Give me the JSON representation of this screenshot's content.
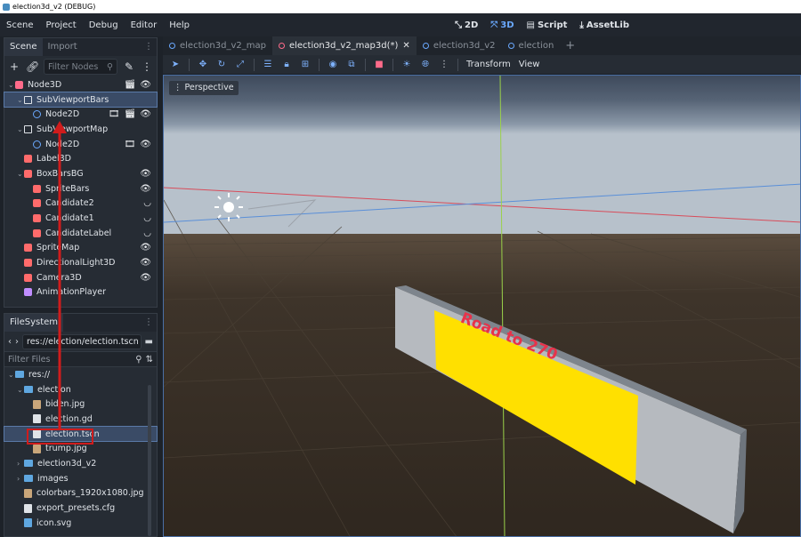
{
  "window": {
    "title": "election3d_v2 (DEBUG)"
  },
  "menu": [
    "Scene",
    "Project",
    "Debug",
    "Editor",
    "Help"
  ],
  "modes": [
    {
      "label": "2D",
      "icon": "2d-icon"
    },
    {
      "label": "3D",
      "icon": "3d-icon",
      "active": true
    },
    {
      "label": "Script",
      "icon": "script-icon"
    },
    {
      "label": "AssetLib",
      "icon": "assetlib-icon"
    }
  ],
  "scene_dock": {
    "tabs": [
      "Scene",
      "Import"
    ],
    "filter_placeholder": "Filter Nodes",
    "nodes": [
      {
        "label": "Node3D",
        "depth": 0,
        "icon_color": "#ff6b8a"
      },
      {
        "label": "SubViewportBars",
        "depth": 1,
        "icon_color": "#dfe3e8",
        "selected": true
      },
      {
        "label": "Node2D",
        "depth": 2,
        "icon_color": "#6aa9ff"
      },
      {
        "label": "SubViewportMap",
        "depth": 1,
        "icon_color": "#dfe3e8"
      },
      {
        "label": "Node2D",
        "depth": 2,
        "icon_color": "#6aa9ff"
      },
      {
        "label": "Label3D",
        "depth": 1,
        "icon_color": "#ff6b6b"
      },
      {
        "label": "BoxBarsBG",
        "depth": 1,
        "icon_color": "#ff6b6b"
      },
      {
        "label": "SpriteBars",
        "depth": 2,
        "icon_color": "#ff6b6b"
      },
      {
        "label": "Candidate2",
        "depth": 2,
        "icon_color": "#ff6b6b"
      },
      {
        "label": "Candidate1",
        "depth": 2,
        "icon_color": "#ff6b6b"
      },
      {
        "label": "CandidateLabel",
        "depth": 2,
        "icon_color": "#ff6b6b"
      },
      {
        "label": "SpriteMap",
        "depth": 1,
        "icon_color": "#ff6b6b"
      },
      {
        "label": "DirectionalLight3D",
        "depth": 1,
        "icon_color": "#ff6b6b"
      },
      {
        "label": "Camera3D",
        "depth": 1,
        "icon_color": "#ff6b6b"
      },
      {
        "label": "AnimationPlayer",
        "depth": 1,
        "icon_color": "#c08dff"
      }
    ]
  },
  "filesystem": {
    "tab": "FileSystem",
    "path": "res://election/election.tscn",
    "filter_placeholder": "Filter Files",
    "items": [
      {
        "label": "res://",
        "depth": 0,
        "kind": "folder"
      },
      {
        "label": "election",
        "depth": 1,
        "kind": "folder"
      },
      {
        "label": "biden.jpg",
        "depth": 2,
        "kind": "image"
      },
      {
        "label": "election.gd",
        "depth": 2,
        "kind": "script"
      },
      {
        "label": "election.tscn",
        "depth": 2,
        "kind": "scene",
        "selected": true
      },
      {
        "label": "trump.jpg",
        "depth": 2,
        "kind": "image"
      },
      {
        "label": "election3d_v2",
        "depth": 1,
        "kind": "folder"
      },
      {
        "label": "images",
        "depth": 1,
        "kind": "folder"
      },
      {
        "label": "colorbars_1920x1080.jpg",
        "depth": 1,
        "kind": "image"
      },
      {
        "label": "export_presets.cfg",
        "depth": 1,
        "kind": "config"
      },
      {
        "label": "icon.svg",
        "depth": 1,
        "kind": "svg"
      }
    ]
  },
  "editor": {
    "tabs": [
      {
        "label": "election3d_v2_map"
      },
      {
        "label": "election3d_v2_map3d(*)",
        "selected": true
      },
      {
        "label": "election3d_v2"
      },
      {
        "label": "election"
      }
    ],
    "toolbar_menus": [
      "Transform",
      "View"
    ],
    "viewport_mode": "Perspective",
    "label3d_text": "Road to 270"
  },
  "colors": {
    "accent": "#6aa9ff",
    "selection": "#3a4b66",
    "bar_fill": "#ffe000",
    "label3d": "#e8324a",
    "annotation": "#d01c1c"
  }
}
